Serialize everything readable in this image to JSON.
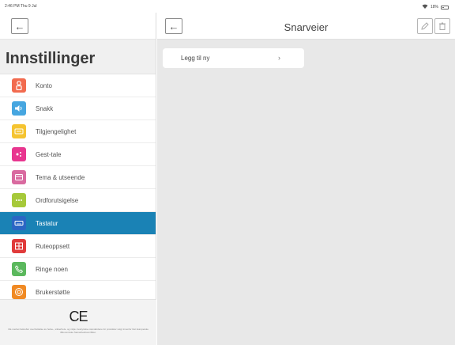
{
  "status_bar": {
    "time": "2:46 PM  Thu 9 Jul",
    "battery": "18%",
    "icons": [
      "wifi-icon",
      "battery-icon"
    ]
  },
  "left_panel": {
    "title": "Innstillinger",
    "items": [
      {
        "label": "Konto",
        "icon": "person-icon",
        "color": "#f26b4f"
      },
      {
        "label": "Snakk",
        "icon": "speaker-icon",
        "color": "#46a6e0"
      },
      {
        "label": "Tilgjengelighet",
        "icon": "accessibility-icon",
        "color": "#f5c431"
      },
      {
        "label": "Gest-tale",
        "icon": "gesture-icon",
        "color": "#e8368f"
      },
      {
        "label": "Tema & utseende",
        "icon": "theme-icon",
        "color": "#d96aa0"
      },
      {
        "label": "Ordforutsigelse",
        "icon": "prediction-icon",
        "color": "#a6c93a"
      },
      {
        "label": "Tastatur",
        "icon": "keyboard-icon",
        "color": "#2b66c4",
        "active": true
      },
      {
        "label": "Ruteoppsett",
        "icon": "grid-icon",
        "color": "#e03b3b"
      },
      {
        "label": "Ringe noen",
        "icon": "phone-icon",
        "color": "#5bb85d"
      },
      {
        "label": "Brukerstøtte",
        "icon": "support-icon",
        "color": "#f08a24"
      }
    ],
    "footer": {
      "ce_mark": "CE",
      "fine_print": "CE-merket bekrefter overholdelse av helse-, sikkerhets- og miljø- beskyttelse standardene for produkter solgt innenfor Det Europeiske Økonomiske Samarbeidsområdet."
    }
  },
  "right_panel": {
    "title": "Snarveier",
    "add_row_label": "Legg til ny"
  }
}
